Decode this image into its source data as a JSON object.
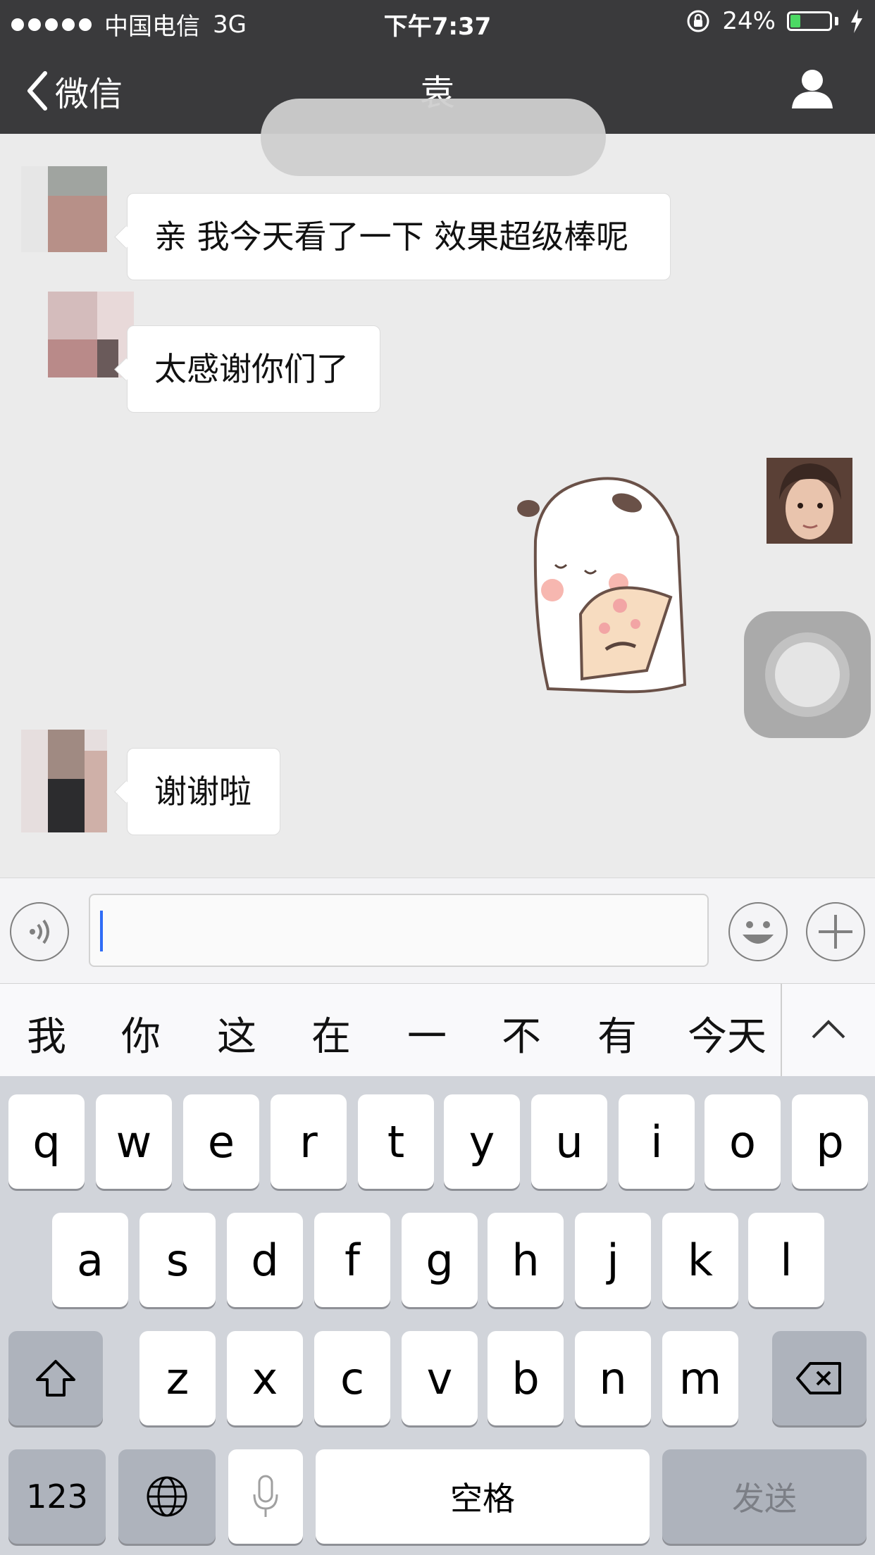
{
  "status_bar": {
    "carrier": "中国电信",
    "network": "3G",
    "time": "下午7:37",
    "battery_percent": "24%",
    "battery_level": 0.24,
    "icons": [
      "signal-dots-icon",
      "rotation-lock-icon",
      "battery-icon",
      "charging-bolt-icon"
    ]
  },
  "nav": {
    "back_label": "微信",
    "title": "袁",
    "icons": [
      "chevron-left-icon",
      "profile-icon"
    ]
  },
  "messages": [
    {
      "side": "left",
      "type": "text",
      "text": "亲 我今天看了一下 效果超级棒呢"
    },
    {
      "side": "left",
      "type": "text",
      "text": "太感谢你们了"
    },
    {
      "side": "right",
      "type": "sticker",
      "sticker": "panda-fan-sticker"
    },
    {
      "side": "left",
      "type": "text",
      "text": "谢谢啦"
    }
  ],
  "input_bar": {
    "value": "",
    "icons": [
      "voice-icon",
      "emoji-icon",
      "plus-icon"
    ]
  },
  "candidates": [
    "我",
    "你",
    "这",
    "在",
    "一",
    "不",
    "有",
    "今天"
  ],
  "keyboard": {
    "row1": [
      "q",
      "w",
      "e",
      "r",
      "t",
      "y",
      "u",
      "i",
      "o",
      "p"
    ],
    "row2": [
      "a",
      "s",
      "d",
      "f",
      "g",
      "h",
      "j",
      "k",
      "l"
    ],
    "row3": [
      "z",
      "x",
      "c",
      "v",
      "b",
      "n",
      "m"
    ],
    "numbers_label": "123",
    "space_label": "空格",
    "send_label": "发送",
    "icons": [
      "shift-icon",
      "backspace-icon",
      "globe-icon",
      "microphone-icon",
      "chevron-up-icon"
    ]
  },
  "colors": {
    "nav_background": "#3a3a3c",
    "chat_background": "#ebebeb",
    "keyboard_background": "#d1d4da",
    "caret": "#2f6cf6",
    "battery_fill": "#4cd964"
  }
}
